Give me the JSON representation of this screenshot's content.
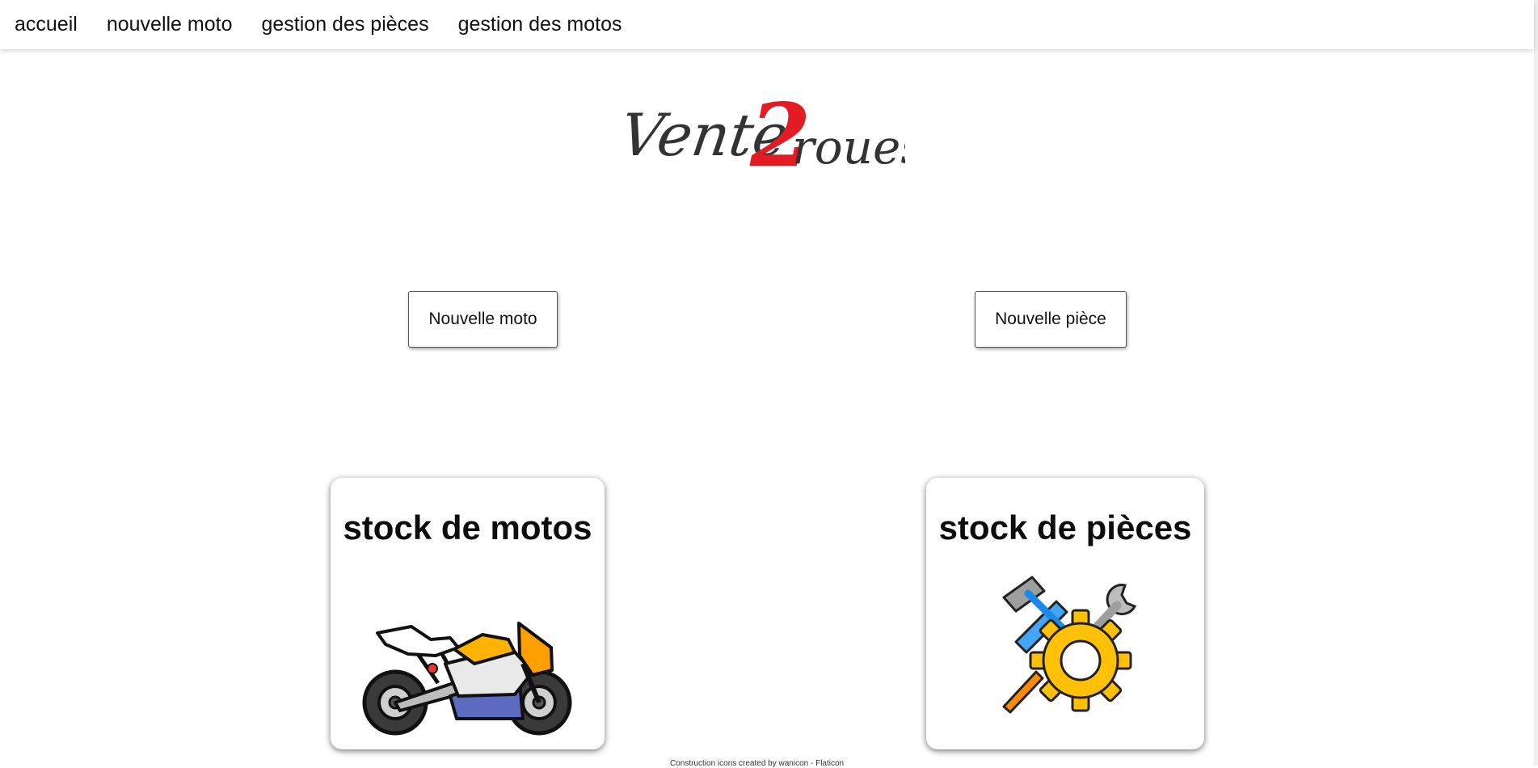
{
  "nav": {
    "items": [
      {
        "label": "accueil"
      },
      {
        "label": "nouvelle moto"
      },
      {
        "label": "gestion des pièces"
      },
      {
        "label": "gestion des motos"
      }
    ]
  },
  "logo": {
    "text_part1": "Vente",
    "text_digit": "2",
    "text_part2": "roues",
    "colors": {
      "text": "#333333",
      "digit": "#e31b23"
    }
  },
  "actions": {
    "new_moto_label": "Nouvelle moto",
    "new_piece_label": "Nouvelle pièce"
  },
  "cards": {
    "motos": {
      "title": "stock de motos",
      "icon": "motorcycle-icon"
    },
    "pieces": {
      "title": "stock de pièces",
      "icon": "tools-gear-icon"
    }
  },
  "footer": {
    "credit": "Construction icons created by wanicon - Flaticon"
  }
}
